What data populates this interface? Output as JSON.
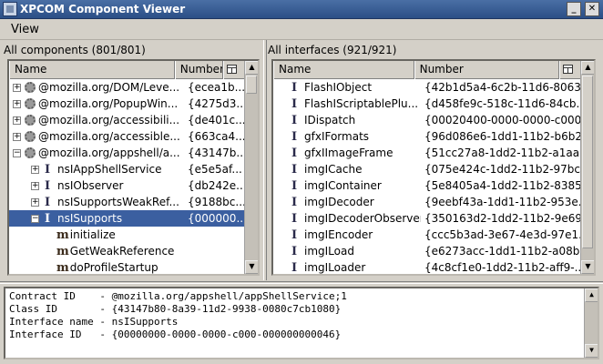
{
  "window": {
    "title": "XPCOM Component Viewer"
  },
  "menu": {
    "view": "View"
  },
  "components": {
    "label": "All components (801/801)",
    "columns": {
      "name": "Name",
      "number": "Number"
    },
    "rows": [
      {
        "kind": "component",
        "twisty": "+",
        "name": "@mozilla.org/DOM/Leve...",
        "number": "{ecea1b..."
      },
      {
        "kind": "component",
        "twisty": "+",
        "name": "@mozilla.org/PopupWin...",
        "number": "{4275d3..."
      },
      {
        "kind": "component",
        "twisty": "+",
        "name": "@mozilla.org/accessibili...",
        "number": "{de401c..."
      },
      {
        "kind": "component",
        "twisty": "+",
        "name": "@mozilla.org/accessible...",
        "number": "{663ca4..."
      },
      {
        "kind": "component",
        "twisty": "−",
        "name": "@mozilla.org/appshell/a...",
        "number": "{43147b..."
      },
      {
        "kind": "interface",
        "twisty": "+",
        "glyph": "I",
        "name": "nsIAppShellService",
        "number": "{e5e5af..."
      },
      {
        "kind": "interface",
        "twisty": "+",
        "glyph": "I",
        "name": "nsIObserver",
        "number": "{db242e..."
      },
      {
        "kind": "interface",
        "twisty": "+",
        "glyph": "I",
        "name": "nsISupportsWeakRef...",
        "number": "{9188bc..."
      },
      {
        "kind": "interface",
        "twisty": "−",
        "glyph": "I",
        "name": "nsISupports",
        "number": "{000000...",
        "selected": true
      },
      {
        "kind": "method",
        "glyph": "m",
        "name": "initialize",
        "number": ""
      },
      {
        "kind": "method",
        "glyph": "m",
        "name": "GetWeakReference",
        "number": ""
      },
      {
        "kind": "method",
        "glyph": "m",
        "name": "doProfileStartup",
        "number": ""
      }
    ]
  },
  "interfaces": {
    "label": "All interfaces (921/921)",
    "columns": {
      "name": "Name",
      "number": "Number"
    },
    "rows": [
      {
        "glyph": "I",
        "name": "FlashIObject",
        "number": "{42b1d5a4-6c2b-11d6-8063..."
      },
      {
        "glyph": "I",
        "name": "FlashIScriptablePlu...",
        "number": "{d458fe9c-518c-11d6-84cb..."
      },
      {
        "glyph": "I",
        "name": "IDispatch",
        "number": "{00020400-0000-0000-c000..."
      },
      {
        "glyph": "I",
        "name": "gfxIFormats",
        "number": "{96d086e6-1dd1-11b2-b6b2..."
      },
      {
        "glyph": "I",
        "name": "gfxIImageFrame",
        "number": "{51cc27a8-1dd2-11b2-a1aa..."
      },
      {
        "glyph": "I",
        "name": "imgICache",
        "number": "{075e424c-1dd2-11b2-97bc..."
      },
      {
        "glyph": "I",
        "name": "imgIContainer",
        "number": "{5e8405a4-1dd2-11b2-8385..."
      },
      {
        "glyph": "I",
        "name": "imgIDecoder",
        "number": "{9eebf43a-1dd1-11b2-953e..."
      },
      {
        "glyph": "I",
        "name": "imgIDecoderObserver",
        "number": "{350163d2-1dd2-11b2-9e69..."
      },
      {
        "glyph": "I",
        "name": "imgIEncoder",
        "number": "{ccc5b3ad-3e67-4e3d-97e1..."
      },
      {
        "glyph": "I",
        "name": "imgILoad",
        "number": "{e6273acc-1dd1-11b2-a08b..."
      },
      {
        "glyph": "I",
        "name": "imgILoader",
        "number": "{4c8cf1e0-1dd2-11b2-aff9-..."
      }
    ]
  },
  "details": [
    "Contract ID    - @mozilla.org/appshell/appShellService;1",
    "Class ID       - {43147b80-8a39-11d2-9938-0080c7cb1080}",
    "Interface name - nsISupports",
    "Interface ID   - {00000000-0000-0000-c000-000000000046}"
  ]
}
